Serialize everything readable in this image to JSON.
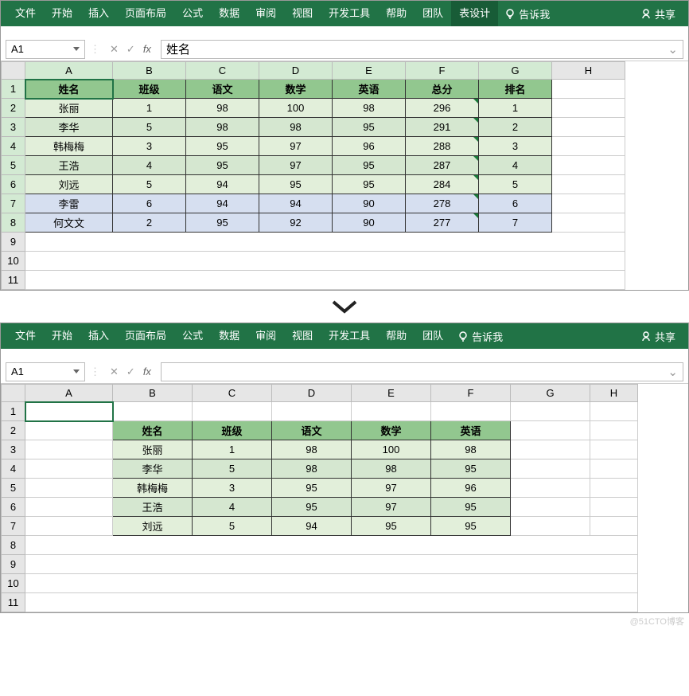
{
  "ribbon": {
    "tabs": [
      "文件",
      "开始",
      "插入",
      "页面布局",
      "公式",
      "数据",
      "审阅",
      "视图",
      "开发工具",
      "帮助",
      "团队",
      "表设计"
    ],
    "activeTop": "表设计",
    "tell": "告诉我",
    "share": "共享"
  },
  "top": {
    "namebox": "A1",
    "formula": "姓名",
    "cols": [
      "A",
      "B",
      "C",
      "D",
      "E",
      "F",
      "G",
      "H"
    ],
    "rows": [
      1,
      2,
      3,
      4,
      5,
      6,
      7,
      8,
      9,
      10,
      11
    ],
    "header": [
      "姓名",
      "班级",
      "语文",
      "数学",
      "英语",
      "总分",
      "排名"
    ],
    "data": [
      [
        "张丽",
        "1",
        "98",
        "100",
        "98",
        "296",
        "1"
      ],
      [
        "李华",
        "5",
        "98",
        "98",
        "95",
        "291",
        "2"
      ],
      [
        "韩梅梅",
        "3",
        "95",
        "97",
        "96",
        "288",
        "3"
      ],
      [
        "王浩",
        "4",
        "95",
        "97",
        "95",
        "287",
        "4"
      ],
      [
        "刘远",
        "5",
        "94",
        "95",
        "95",
        "284",
        "5"
      ],
      [
        "李雷",
        "6",
        "94",
        "94",
        "90",
        "278",
        "6"
      ],
      [
        "何文文",
        "2",
        "95",
        "92",
        "90",
        "277",
        "7"
      ]
    ]
  },
  "bottom": {
    "namebox": "A1",
    "formula": "",
    "ribbonTabs": [
      "文件",
      "开始",
      "插入",
      "页面布局",
      "公式",
      "数据",
      "审阅",
      "视图",
      "开发工具",
      "帮助",
      "团队"
    ],
    "tell": "告诉我",
    "share": "共享",
    "cols": [
      "A",
      "B",
      "C",
      "D",
      "E",
      "F",
      "G",
      "H"
    ],
    "rows": [
      1,
      2,
      3,
      4,
      5,
      6,
      7,
      8,
      9,
      10,
      11
    ],
    "header": [
      "姓名",
      "班级",
      "语文",
      "数学",
      "英语"
    ],
    "data": [
      [
        "张丽",
        "1",
        "98",
        "100",
        "98"
      ],
      [
        "李华",
        "5",
        "98",
        "98",
        "95"
      ],
      [
        "韩梅梅",
        "3",
        "95",
        "97",
        "96"
      ],
      [
        "王浩",
        "4",
        "95",
        "97",
        "95"
      ],
      [
        "刘远",
        "5",
        "94",
        "95",
        "95"
      ]
    ]
  },
  "watermark": "@51CTO博客"
}
